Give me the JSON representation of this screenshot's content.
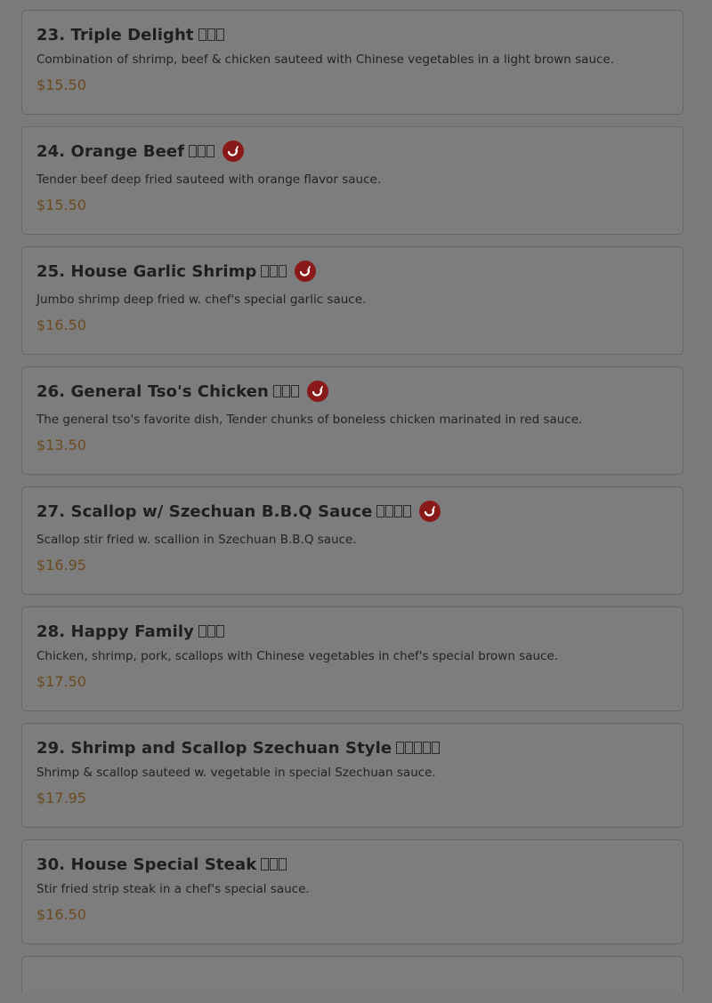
{
  "menu": {
    "items": [
      {
        "title": "23. Triple Delight",
        "cn_chars": 3,
        "spicy": false,
        "description": "Combination of shrimp, beef & chicken sauteed with Chinese vegetables in a light brown sauce.",
        "price": "$15.50"
      },
      {
        "title": "24. Orange Beef",
        "cn_chars": 3,
        "spicy": true,
        "description": "Tender beef deep fried sauteed with orange flavor sauce.",
        "price": "$15.50"
      },
      {
        "title": "25. House Garlic Shrimp",
        "cn_chars": 3,
        "spicy": true,
        "description": "Jumbo shrimp deep fried w. chef's special garlic sauce.",
        "price": "$16.50"
      },
      {
        "title": "26. General Tso's Chicken",
        "cn_chars": 3,
        "spicy": true,
        "description": "The general tso's favorite dish, Tender chunks of boneless chicken marinated in red sauce.",
        "price": "$13.50"
      },
      {
        "title": "27. Scallop w/ Szechuan B.B.Q Sauce",
        "cn_chars": 4,
        "spicy": true,
        "description": "Scallop stir fried w. scallion in Szechuan B.B.Q sauce.",
        "price": "$16.95"
      },
      {
        "title": "28. Happy Family",
        "cn_chars": 3,
        "spicy": false,
        "description": "Chicken, shrimp, pork, scallops with Chinese vegetables in chef's special brown sauce.",
        "price": "$17.50"
      },
      {
        "title": "29. Shrimp and Scallop Szechuan Style",
        "cn_chars": 5,
        "spicy": false,
        "description": "Shrimp & scallop sauteed w. vegetable in special Szechuan sauce.",
        "price": "$17.95"
      },
      {
        "title": "30. House Special Steak",
        "cn_chars": 3,
        "spicy": false,
        "description": "Stir fried strip steak in a chef's special sauce.",
        "price": "$16.50"
      }
    ]
  },
  "icons": {
    "spicy": "chili-pepper-icon"
  },
  "colors": {
    "overlay_background": "#7b7b7b",
    "card_border": "#666666",
    "title": "#1f1f1f",
    "price": "#6b4a1f",
    "spicy_badge": "#8a1a1a"
  }
}
